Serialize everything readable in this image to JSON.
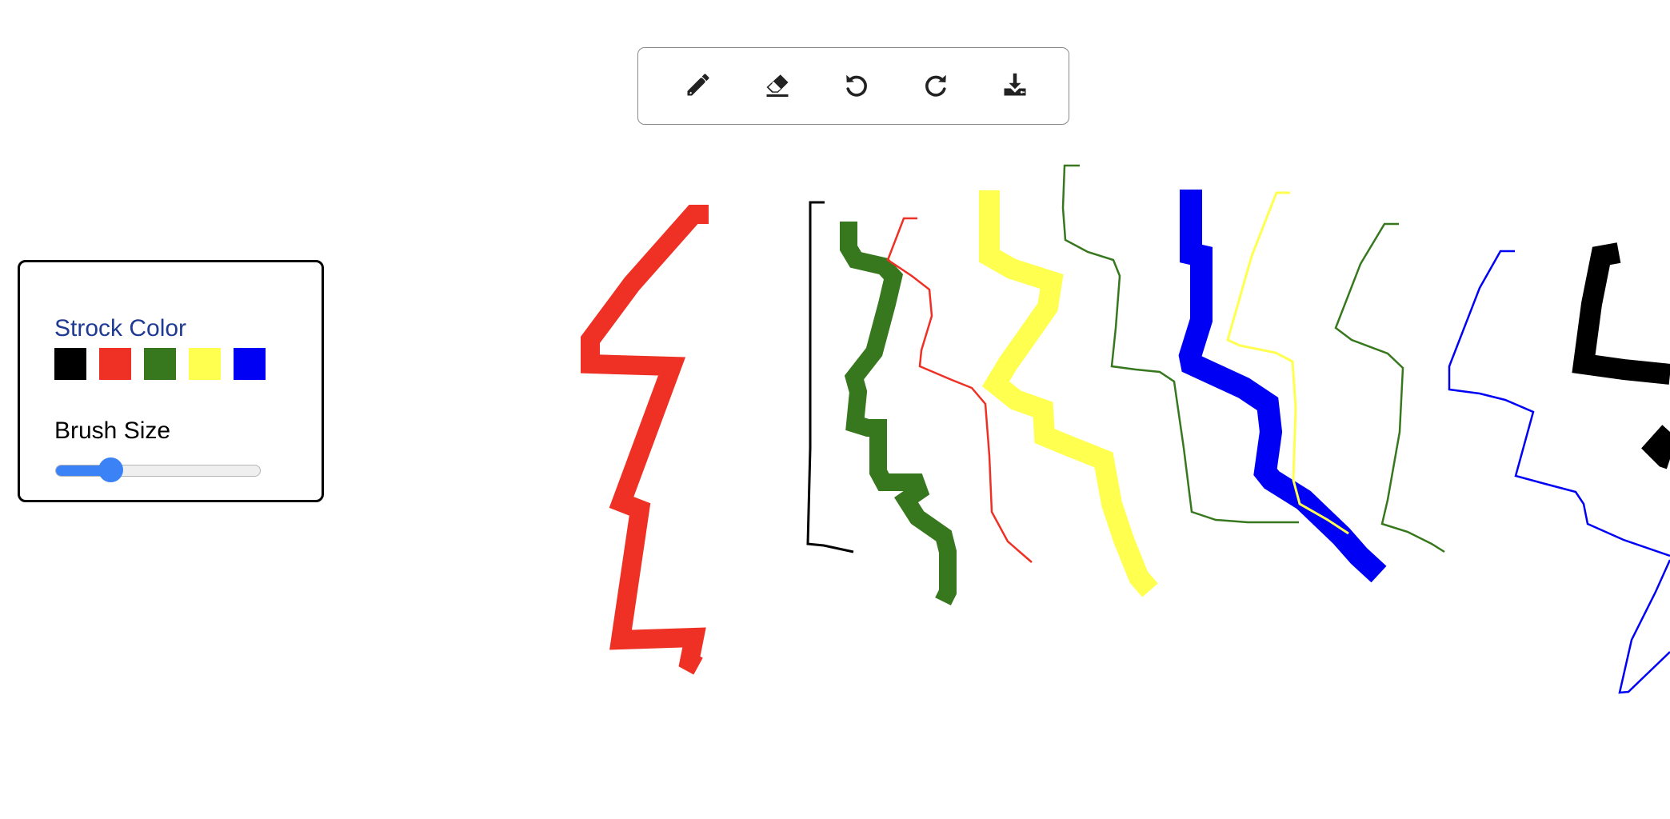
{
  "panel": {
    "stroke_color_label": "Strock Color",
    "brush_size_label": "Brush Size",
    "colors": [
      {
        "name": "black",
        "hex": "#000000"
      },
      {
        "name": "red",
        "hex": "#ee3124"
      },
      {
        "name": "green",
        "hex": "#37781e"
      },
      {
        "name": "yellow",
        "hex": "#ffff50"
      },
      {
        "name": "blue",
        "hex": "#0000f5"
      }
    ],
    "brush_size_fraction": 0.27
  },
  "toolbar": {
    "tools": [
      {
        "name": "pencil-tool-button",
        "icon": "pencil-icon"
      },
      {
        "name": "eraser-tool-button",
        "icon": "eraser-icon"
      },
      {
        "name": "undo-button",
        "icon": "undo-icon"
      },
      {
        "name": "redo-button",
        "icon": "redo-icon"
      },
      {
        "name": "download-button",
        "icon": "download-icon"
      }
    ]
  },
  "colors": {
    "accent": "#3b82f6",
    "panel_title": "#1f3a93",
    "border": "#8a8a8a"
  }
}
